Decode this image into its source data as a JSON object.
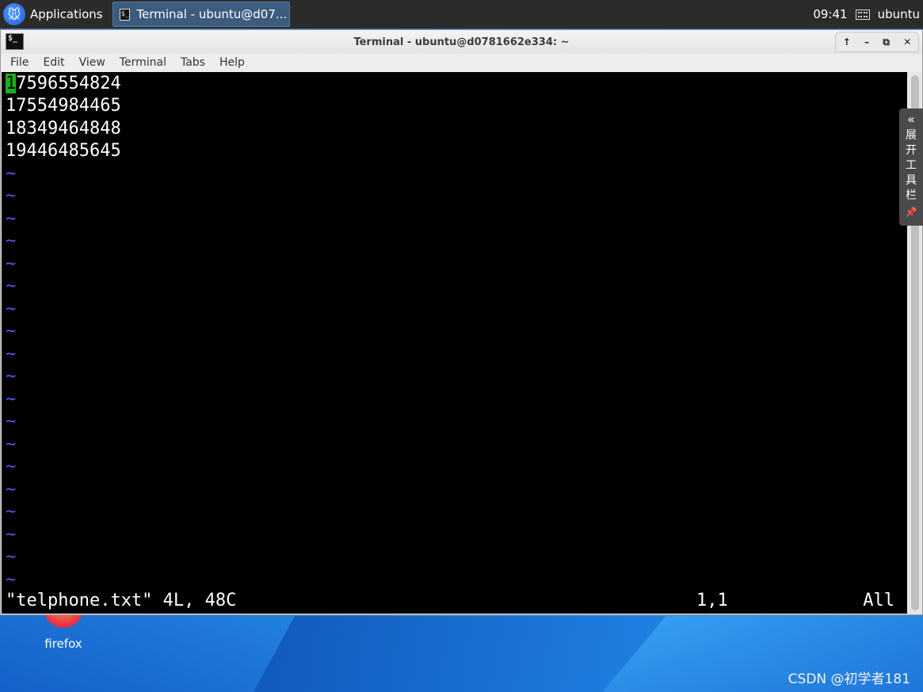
{
  "panel": {
    "applications_label": "Applications",
    "task_label": "Terminal - ubuntu@d07...",
    "clock": "09:41",
    "user": "ubuntu"
  },
  "window": {
    "title": "Terminal - ubuntu@d0781662e334: ~",
    "controls": [
      "↑",
      "–",
      "⧉",
      "✕"
    ]
  },
  "menu": {
    "items": [
      "File",
      "Edit",
      "View",
      "Terminal",
      "Tabs",
      "Help"
    ]
  },
  "terminal": {
    "first_char": "1",
    "first_rest": "7596554824",
    "lines": [
      "17554984465",
      "18349464848",
      "19446485645"
    ],
    "tilde": "~",
    "status_file": "\"telphone.txt\" 4L, 48C",
    "status_pos": "1,1",
    "status_pct": "All"
  },
  "side_toolbar": {
    "chevron": "«",
    "chars": [
      "展",
      "开",
      "工",
      "具",
      "栏"
    ],
    "pin": "📌"
  },
  "desktop": {
    "firefox_label": "firefox",
    "watermark": "CSDN @初学者181"
  },
  "icons": {
    "apps": "xfce-mouse-icon",
    "task": "terminal-icon",
    "keyboard": "keyboard-icon",
    "window": "terminal-icon"
  }
}
